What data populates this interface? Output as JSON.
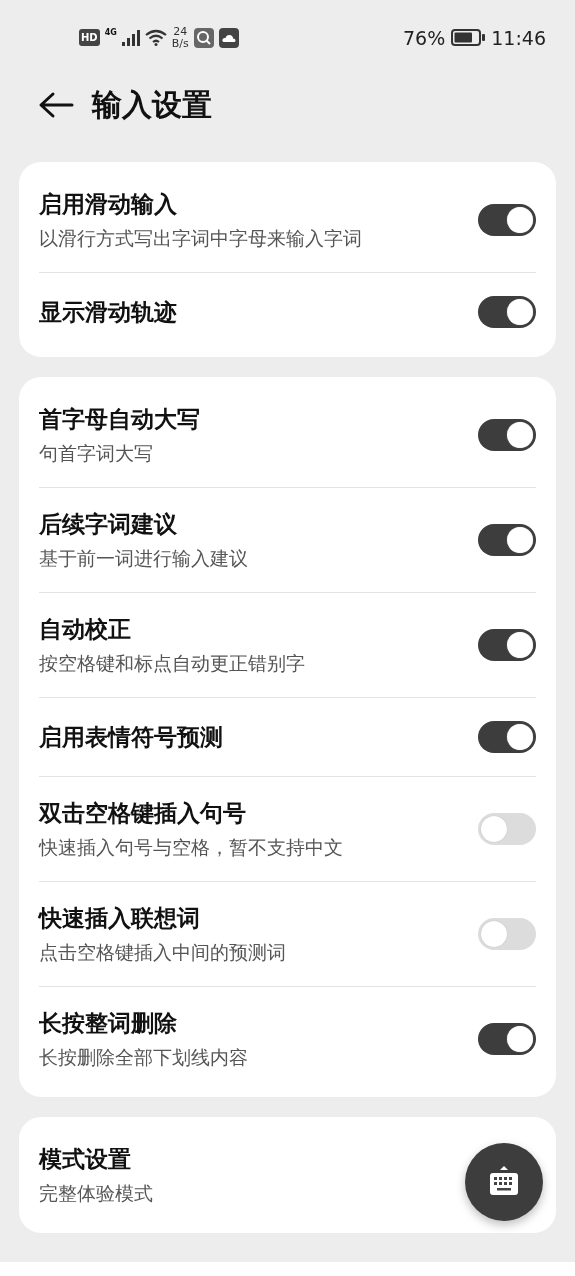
{
  "status_bar": {
    "hd": "HD",
    "network": "4G",
    "speed_value": "24",
    "speed_unit": "B/s",
    "battery_percent": "76%",
    "time": "11:46"
  },
  "header": {
    "title": "输入设置"
  },
  "groups": [
    {
      "items": [
        {
          "kind": "toggle",
          "title": "启用滑动输入",
          "subtitle": "以滑行方式写出字词中字母来输入字词",
          "on": true
        },
        {
          "kind": "toggle",
          "title": "显示滑动轨迹",
          "on": true
        }
      ]
    },
    {
      "items": [
        {
          "kind": "toggle",
          "title": "首字母自动大写",
          "subtitle": "句首字词大写",
          "on": true
        },
        {
          "kind": "toggle",
          "title": "后续字词建议",
          "subtitle": "基于前一词进行输入建议",
          "on": true
        },
        {
          "kind": "toggle",
          "title": "自动校正",
          "subtitle": "按空格键和标点自动更正错别字",
          "on": true
        },
        {
          "kind": "toggle",
          "title": "启用表情符号预测",
          "on": true
        },
        {
          "kind": "toggle",
          "title": "双击空格键插入句号",
          "subtitle": "快速插入句号与空格，暂不支持中文",
          "on": false
        },
        {
          "kind": "toggle",
          "title": "快速插入联想词",
          "subtitle": "点击空格键插入中间的预测词",
          "on": false
        },
        {
          "kind": "toggle",
          "title": "长按整词删除",
          "subtitle": "长按删除全部下划线内容",
          "on": true
        }
      ]
    },
    {
      "items": [
        {
          "kind": "link",
          "title": "模式设置",
          "subtitle": "完整体验模式"
        }
      ]
    }
  ]
}
